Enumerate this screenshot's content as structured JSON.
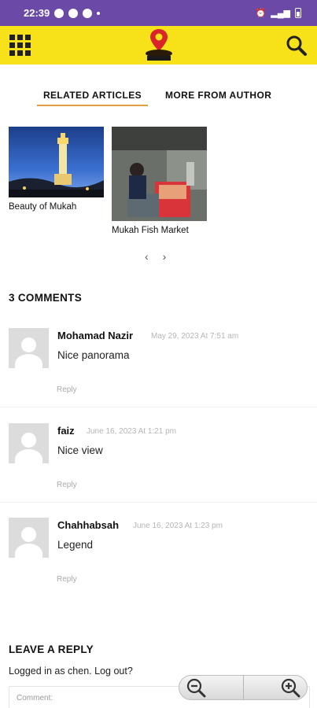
{
  "status_bar": {
    "time": "22:39"
  },
  "tabs": [
    {
      "label": "RELATED ARTICLES",
      "active": true
    },
    {
      "label": "MORE FROM AUTHOR",
      "active": false
    }
  ],
  "articles": [
    {
      "title": "Beauty of Mukah"
    },
    {
      "title": "Mukah Fish Market"
    }
  ],
  "pager": {
    "prev": "‹",
    "next": "›"
  },
  "comments_title": "3 COMMENTS",
  "comments": [
    {
      "author": "Mohamad Nazir",
      "date": "May 29, 2023 At 7:51 am",
      "text": "Nice panorama",
      "reply": "Reply"
    },
    {
      "author": "faiz",
      "date": "June 16, 2023 At 1:21 pm",
      "text": "Nice view",
      "reply": "Reply"
    },
    {
      "author": "Chahhabsah",
      "date": "June 16, 2023 At 1:23 pm",
      "text": "Legend",
      "reply": "Reply"
    }
  ],
  "reply_section": {
    "title": "LEAVE A REPLY",
    "logged_in": "Logged in as chen. Log out?",
    "comment_placeholder": "Comment:"
  },
  "colors": {
    "status_bar": "#6a4aa6",
    "header": "#f7e21a",
    "tab_underline": "#e0a040"
  },
  "icons": [
    "grid-menu-icon",
    "logo-pin-icon",
    "search-icon",
    "zoom-out-icon",
    "zoom-in-icon"
  ]
}
